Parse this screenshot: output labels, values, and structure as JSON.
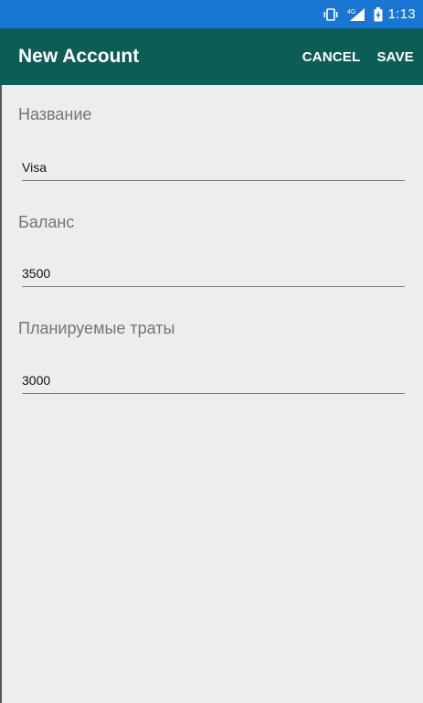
{
  "status_bar": {
    "time": "1:13",
    "icons": [
      "vibrate-icon",
      "signal-4g-icon",
      "battery-icon"
    ],
    "network_label": "4G"
  },
  "app_bar": {
    "title": "New Account",
    "cancel_label": "CANCEL",
    "save_label": "SAVE"
  },
  "form": {
    "name_label": "Название",
    "name_value": "Visa",
    "balance_label": "Баланс",
    "balance_value": "3500",
    "planned_label": "Планируемые траты",
    "planned_value": "3000"
  },
  "colors": {
    "status_bar": "#1976d2",
    "app_bar": "#0d5d57",
    "background": "#ededed"
  }
}
